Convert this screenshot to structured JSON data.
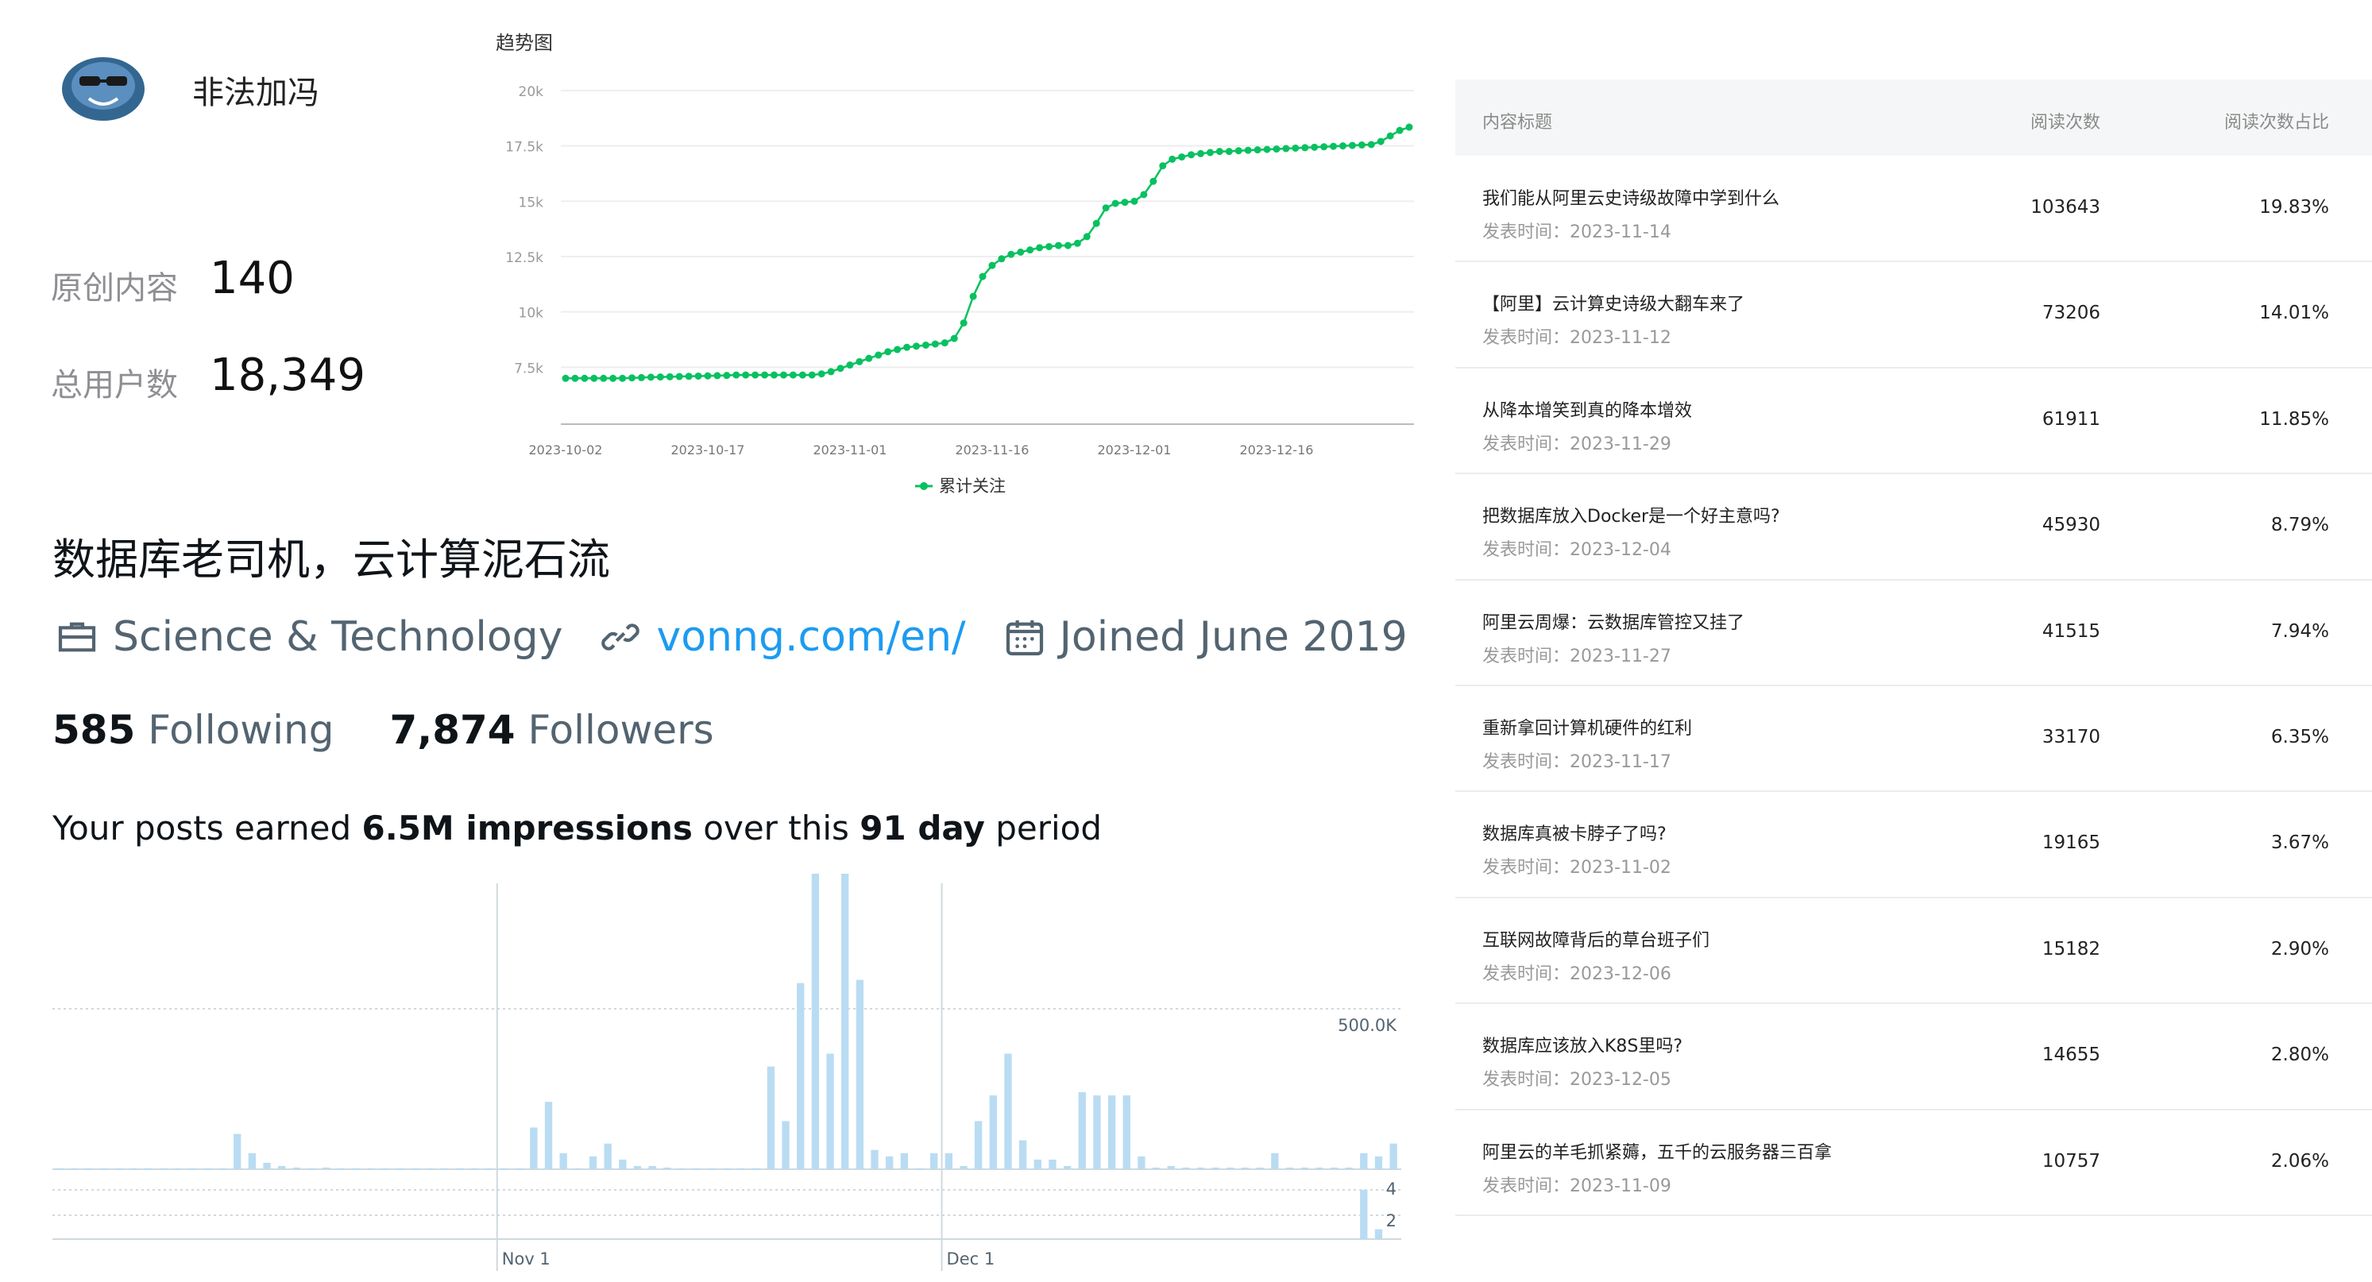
{
  "profile": {
    "name": "非法加冯",
    "stats": [
      {
        "label": "原创内容",
        "value": "140"
      },
      {
        "label": "总用户数",
        "value": "18,349"
      }
    ]
  },
  "trend": {
    "title": "趋势图",
    "legend": "累计关注",
    "color": "#07c160"
  },
  "twitter": {
    "bio": "数据库老司机，云计算泥石流",
    "category": "Science & Technology",
    "website": "vonng.com/en/",
    "joined": "Joined June 2019",
    "following_count": "585",
    "following_label": "Following",
    "followers_count": "7,874",
    "followers_label": "Followers",
    "earned_prefix": "Your posts earned ",
    "earned_impressions": "6.5M impressions",
    "earned_mid": " over this ",
    "earned_days": "91 day",
    "earned_suffix": " period",
    "icons": [
      "briefcase-icon",
      "link-icon",
      "calendar-icon"
    ]
  },
  "table": {
    "headers": [
      "内容标题",
      "阅读次数",
      "阅读次数占比"
    ],
    "date_prefix": "发表时间：",
    "rows": [
      {
        "title": "我们能从阿里云史诗级故障中学到什么",
        "date": "2023-11-14",
        "reads": "103643",
        "pct": "19.83%"
      },
      {
        "title": "【阿里】云计算史诗级大翻车来了",
        "date": "2023-11-12",
        "reads": "73206",
        "pct": "14.01%"
      },
      {
        "title": "从降本增笑到真的降本增效",
        "date": "2023-11-29",
        "reads": "61911",
        "pct": "11.85%"
      },
      {
        "title": "把数据库放入Docker是一个好主意吗?",
        "date": "2023-12-04",
        "reads": "45930",
        "pct": "8.79%"
      },
      {
        "title": "阿里云周爆：云数据库管控又挂了",
        "date": "2023-11-27",
        "reads": "41515",
        "pct": "7.94%"
      },
      {
        "title": "重新拿回计算机硬件的红利",
        "date": "2023-11-17",
        "reads": "33170",
        "pct": "6.35%"
      },
      {
        "title": "数据库真被卡脖子了吗?",
        "date": "2023-11-02",
        "reads": "19165",
        "pct": "3.67%"
      },
      {
        "title": "互联网故障背后的草台班子们",
        "date": "2023-12-06",
        "reads": "15182",
        "pct": "2.90%"
      },
      {
        "title": "数据库应该放入K8S里吗?",
        "date": "2023-12-05",
        "reads": "14655",
        "pct": "2.80%"
      },
      {
        "title": "阿里云的羊毛抓紧薅，五千的云服务器三百拿",
        "date": "2023-11-09",
        "reads": "10757",
        "pct": "2.06%"
      }
    ]
  },
  "chart_data": [
    {
      "type": "line",
      "title": "趋势图",
      "series": [
        {
          "name": "累计关注",
          "values": [
            7000,
            7000,
            7000,
            7000,
            7000,
            7000,
            7000,
            7020,
            7030,
            7050,
            7060,
            7070,
            7080,
            7090,
            7100,
            7110,
            7120,
            7130,
            7150,
            7150,
            7150,
            7150,
            7150,
            7150,
            7150,
            7150,
            7150,
            7200,
            7300,
            7450,
            7600,
            7750,
            7900,
            8050,
            8200,
            8300,
            8400,
            8450,
            8500,
            8550,
            8600,
            8800,
            9500,
            10700,
            11600,
            12100,
            12400,
            12600,
            12700,
            12800,
            12900,
            12950,
            13000,
            13000,
            13100,
            13400,
            14000,
            14700,
            14900,
            14950,
            15000,
            15300,
            15900,
            16600,
            16900,
            17000,
            17100,
            17150,
            17200,
            17250,
            17250,
            17280,
            17300,
            17320,
            17340,
            17360,
            17380,
            17400,
            17420,
            17440,
            17460,
            17480,
            17500,
            17520,
            17540,
            17560,
            17700,
            17950,
            18200,
            18349
          ]
        }
      ],
      "x_tick_labels": [
        "2023-10-02",
        "2023-10-17",
        "2023-11-01",
        "2023-11-16",
        "2023-12-01",
        "2023-12-16"
      ],
      "y_tick_labels": [
        "7.5k",
        "10k",
        "12.5k",
        "15k",
        "17.5k",
        "20k"
      ],
      "ylim": [
        5000,
        20000
      ],
      "legend_position": "bottom-center",
      "grid": true
    },
    {
      "type": "bar",
      "title": "",
      "series": [
        {
          "name": "",
          "values": [
            0,
            0,
            0,
            0,
            0,
            0,
            0,
            0,
            0,
            0,
            0,
            0,
            0,
            0,
            0,
            0,
            0,
            0,
            0,
            0,
            0,
            0,
            0,
            0,
            0,
            0,
            0,
            0,
            0,
            0,
            0,
            0,
            0,
            0,
            0,
            0,
            0,
            0,
            0,
            0,
            0,
            0,
            0,
            0,
            0,
            0,
            0,
            0,
            0,
            0,
            0,
            0,
            0,
            0,
            0,
            0,
            0,
            0,
            0,
            0,
            0,
            0,
            0,
            0,
            0,
            0,
            0,
            0,
            0,
            0,
            0,
            0,
            0,
            0,
            0,
            0,
            0,
            0,
            0,
            0,
            0,
            0,
            0,
            0,
            0,
            0,
            0,
            0,
            0,
            0,
            0
          ],
          "values_note_free": true
        },
        {
          "name": "",
          "values": [
            0,
            0,
            0,
            0,
            0,
            0,
            0,
            0,
            0,
            0,
            0,
            0,
            0,
            0,
            0,
            0,
            0,
            0,
            0,
            0,
            0,
            0,
            0,
            0,
            0,
            0,
            0,
            0,
            0,
            0,
            0,
            0,
            0,
            0,
            0,
            0,
            0,
            0,
            0,
            0,
            0,
            0,
            0,
            0,
            0,
            0,
            0,
            0,
            0,
            0,
            0,
            0,
            0,
            0,
            0,
            0,
            0,
            0,
            0,
            0,
            0,
            0,
            0,
            0,
            0,
            0,
            0,
            0,
            0,
            0,
            0,
            0,
            0,
            0,
            0,
            0,
            0,
            0,
            0,
            0,
            0,
            0,
            0,
            0,
            0,
            0,
            0,
            0,
            5,
            1,
            0
          ]
        }
      ],
      "impressions": [
        3000,
        3000,
        3000,
        3000,
        3000,
        3000,
        3000,
        3000,
        3000,
        3000,
        3000,
        3000,
        110000,
        50000,
        20000,
        10000,
        5000,
        3000,
        5000,
        3000,
        3000,
        3000,
        3000,
        3000,
        3000,
        3000,
        3000,
        3000,
        3000,
        3000,
        3000,
        3000,
        130000,
        210000,
        50000,
        3000,
        40000,
        80000,
        30000,
        10000,
        10000,
        5000,
        3000,
        3000,
        3000,
        3000,
        3000,
        3000,
        320000,
        150000,
        580000,
        1150000,
        360000,
        1150000,
        590000,
        60000,
        40000,
        50000,
        3000,
        50000,
        50000,
        10000,
        150000,
        230000,
        360000,
        90000,
        30000,
        30000,
        10000,
        240000,
        230000,
        230000,
        230000,
        40000,
        5000,
        10000,
        5000,
        5000,
        5000,
        5000,
        5000,
        5000,
        50000,
        5000,
        5000,
        5000,
        5000,
        5000,
        50000,
        40000,
        80000
      ],
      "x_tick_labels": [
        "Nov 1",
        "Dec 1"
      ],
      "y_tick_labels": [
        "500.0K"
      ],
      "secondary_y_tick_labels": [
        "4",
        "2"
      ],
      "grid": true
    }
  ]
}
